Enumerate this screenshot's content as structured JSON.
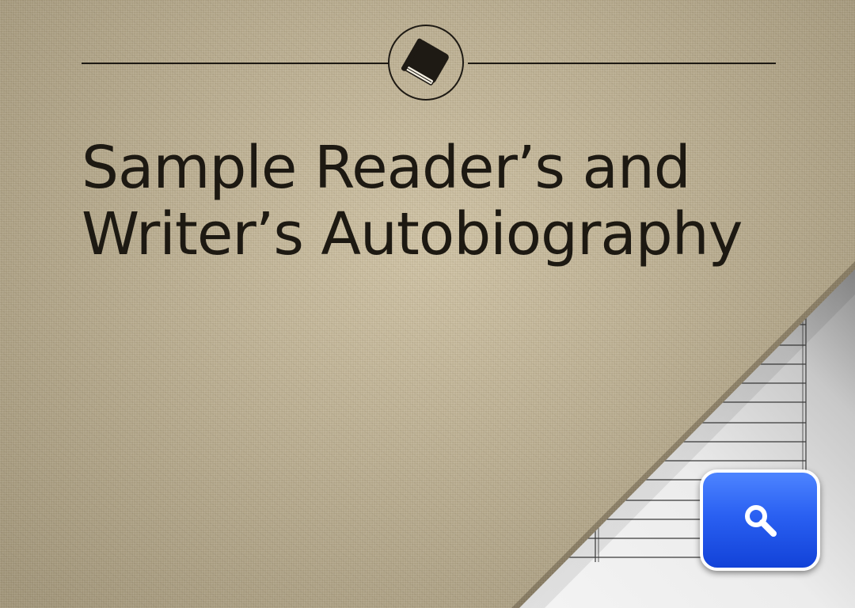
{
  "book": {
    "title_line1": "Sample Reader’s and",
    "title_line2": "Writer’s Autobiography"
  },
  "icons": {
    "header_icon": "book-icon",
    "action_icon": "magnifying-glass-icon"
  },
  "colors": {
    "linen": "#c9b994",
    "ink": "#1d1912",
    "button_blue": "#2a60f2",
    "button_border": "#ffffff"
  }
}
